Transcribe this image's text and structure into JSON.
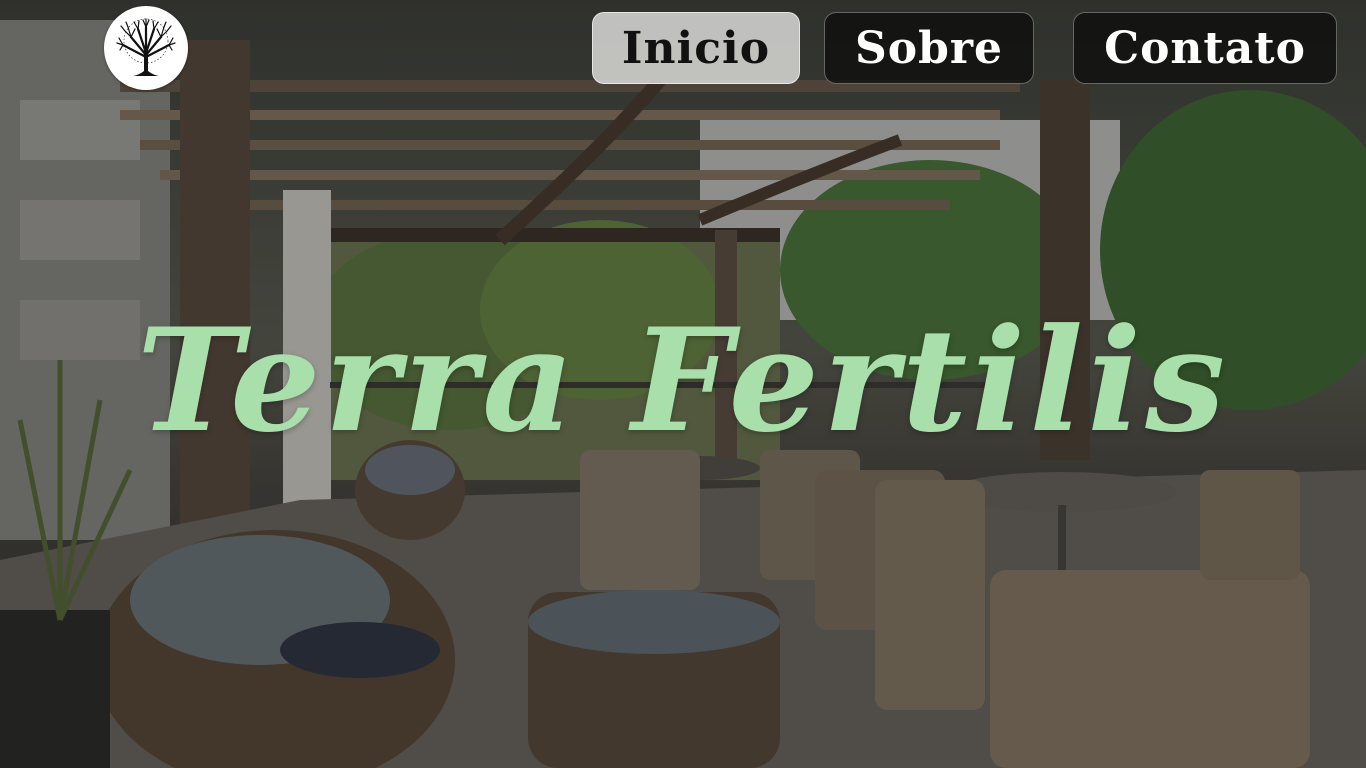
{
  "site": {
    "title": "Terra Fertilis",
    "logo_icon": "tree-icon"
  },
  "nav": {
    "items": [
      {
        "label": "Inicio",
        "active": true
      },
      {
        "label": "Sobre",
        "active": false
      },
      {
        "label": "Contato",
        "active": false
      }
    ]
  },
  "colors": {
    "title": "#a8dfaa",
    "nav_background": "#0a0a0a",
    "nav_active_background": "#e1e1de",
    "logo_background": "#ffffff"
  }
}
